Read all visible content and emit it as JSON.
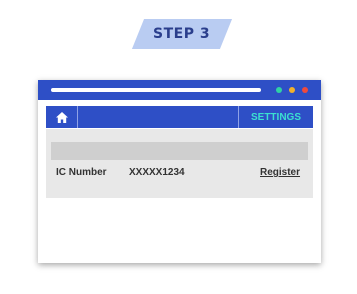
{
  "step": {
    "label": "STEP 3"
  },
  "window": {
    "controls": [
      "green-dot",
      "yellow-dot",
      "red-dot"
    ]
  },
  "nav": {
    "home_icon": "home-icon",
    "settings_label": "SETTINGS"
  },
  "form": {
    "ic_label": "IC Number",
    "ic_value": "XXXXX1234",
    "register_label": "Register"
  },
  "colors": {
    "brand_blue": "#2e4fc6",
    "settings_accent": "#3be0d0",
    "badge_bg": "#b9ccf2"
  }
}
